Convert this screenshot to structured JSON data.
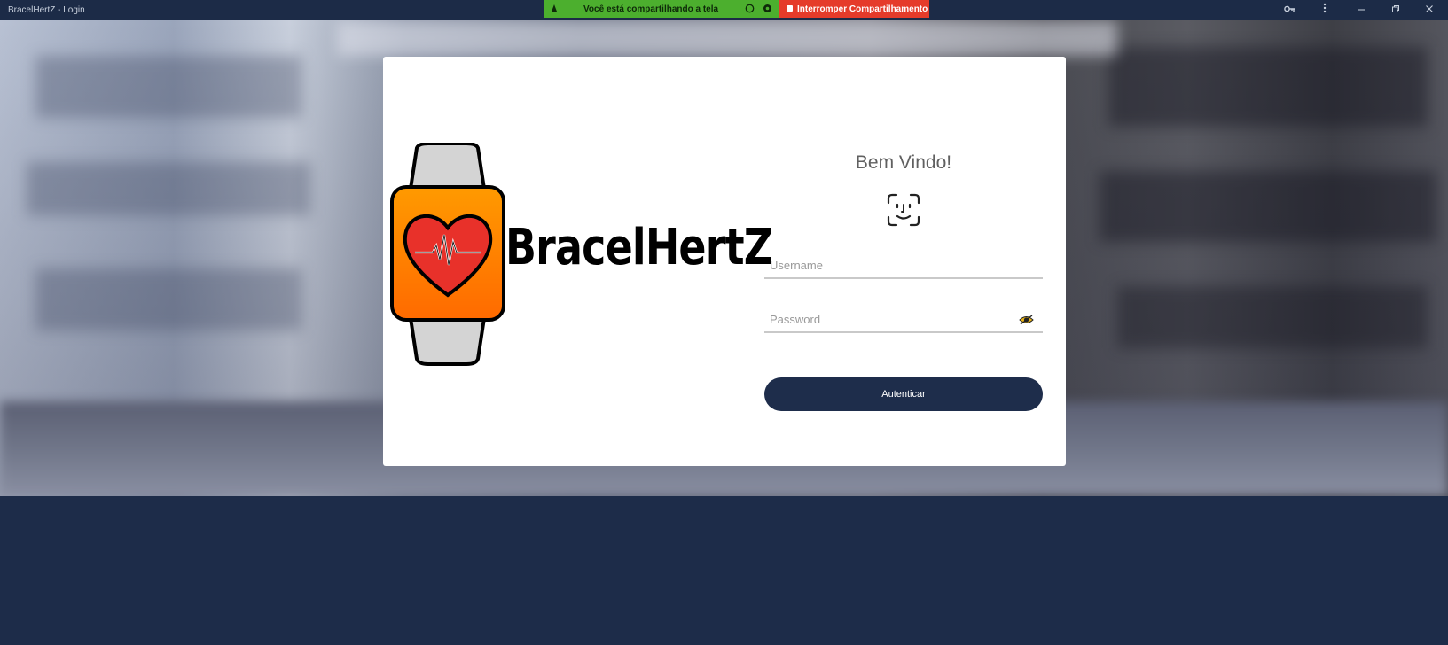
{
  "window": {
    "title": "BracelHertZ - Login",
    "controls": [
      "key-icon",
      "more-vert-icon",
      "minimize-icon",
      "restore-icon",
      "close-icon"
    ]
  },
  "share_bar": {
    "status_text": "Você está compartilhando a tela",
    "stop_label": "Interromper Compartilhamento",
    "green": "#4caf2e",
    "red": "#e53b2a"
  },
  "login": {
    "brand": "BracelHertZ",
    "welcome": "Bem Vindo!",
    "username_placeholder": "Username",
    "password_placeholder": "Password",
    "submit_label": "Autenticar",
    "accent": "#1e2d4b"
  },
  "colors": {
    "page_bg": "#1d2c49",
    "card_bg": "#ffffff",
    "logo_orange": "#ff8a00",
    "logo_red": "#e8312a"
  }
}
